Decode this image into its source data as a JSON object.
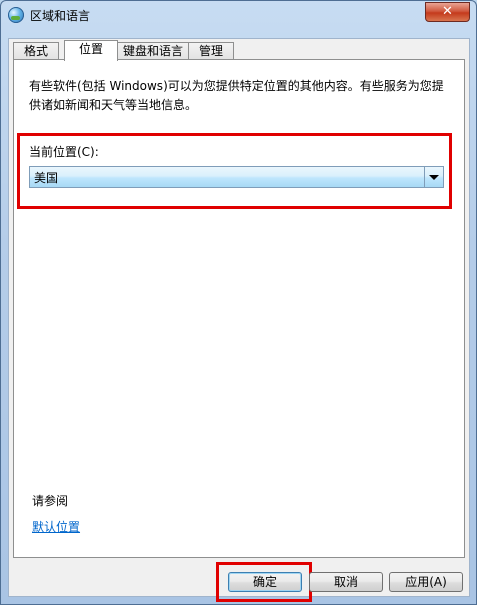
{
  "window": {
    "title": "区域和语言",
    "close_label": "✕"
  },
  "tabs": [
    {
      "label": "格式"
    },
    {
      "label": "位置"
    },
    {
      "label": "键盘和语言"
    },
    {
      "label": "管理"
    }
  ],
  "location_tab": {
    "description": "有些软件(包括 Windows)可以为您提供特定位置的其他内容。有些服务为您提供诸如新闻和天气等当地信息。",
    "current_location_label": "当前位置(C):",
    "current_location_value": "美国",
    "see_also_label": "请参阅",
    "default_location_link": "默认位置"
  },
  "buttons": {
    "ok": "确定",
    "cancel": "取消",
    "apply": "应用(A)"
  },
  "colors": {
    "highlight_box": "#e00000",
    "link": "#0066cc"
  },
  "icons": {
    "app": "globe-icon",
    "dropdown": "chevron-down-icon"
  }
}
